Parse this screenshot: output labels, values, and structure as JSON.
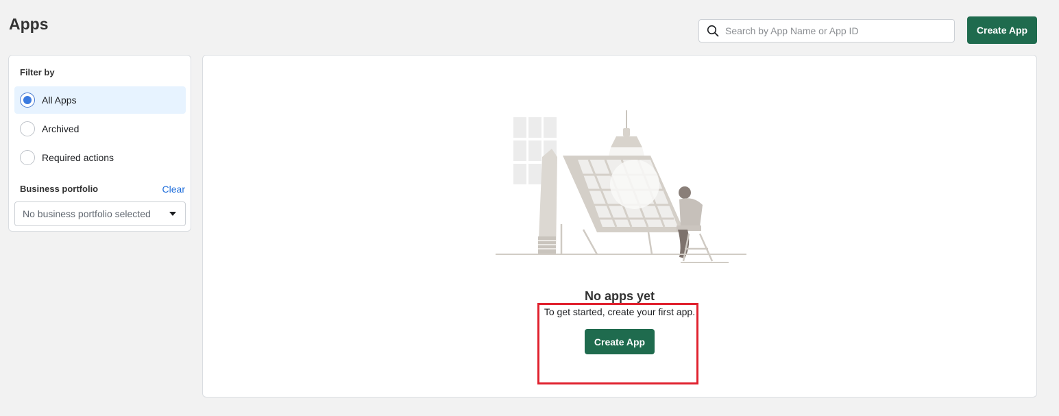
{
  "header": {
    "title": "Apps",
    "search_placeholder": "Search by App Name or App ID",
    "search_value": "",
    "search_icon": "search-icon",
    "create_label": "Create App"
  },
  "filter": {
    "title": "Filter by",
    "options": [
      {
        "label": "All Apps",
        "selected": true
      },
      {
        "label": "Archived",
        "selected": false
      },
      {
        "label": "Required actions",
        "selected": false
      }
    ],
    "business_portfolio": {
      "title": "Business portfolio",
      "clear_label": "Clear",
      "selected": "No business portfolio selected",
      "caret_icon": "caret-down-icon"
    }
  },
  "empty_state": {
    "title": "No apps yet",
    "subtitle": "To get started, create your first app.",
    "create_label": "Create App"
  },
  "colors": {
    "primary_button": "#1f6b4e",
    "link": "#216fdb",
    "selected_bg": "#e7f3ff",
    "highlight": "#e0212e"
  }
}
